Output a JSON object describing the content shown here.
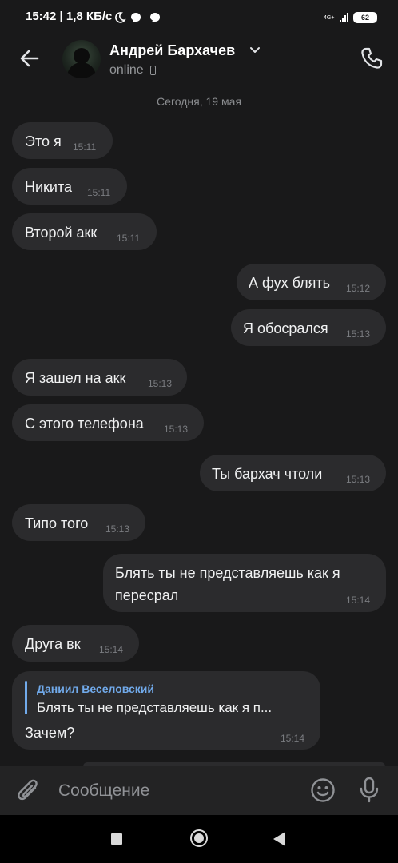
{
  "status_bar": {
    "time_and_speed": "15:42 | 1,8 КБ/с",
    "network": "4G+",
    "battery": "62"
  },
  "header": {
    "contact_name": "Андрей Бархачев",
    "status": "online"
  },
  "date_separator": "Сегодня, 19 мая",
  "messages": [
    {
      "text": "Это я",
      "time": "15:11",
      "side": "in"
    },
    {
      "text": "Никита",
      "time": "15:11",
      "side": "in"
    },
    {
      "text": "Второй акк",
      "time": "15:11",
      "side": "in"
    },
    {
      "text": "А фух блять",
      "time": "15:12",
      "side": "out"
    },
    {
      "text": "Я обосрался",
      "time": "15:13",
      "side": "out"
    },
    {
      "text": "Я зашел на акк",
      "time": "15:13",
      "side": "in"
    },
    {
      "text": "С этого телефона",
      "time": "15:13",
      "side": "in"
    },
    {
      "text": "Ты бархач чтоли",
      "time": "15:13",
      "side": "out"
    },
    {
      "text": "Типо того",
      "time": "15:13",
      "side": "in"
    },
    {
      "text_line1": "Блять ты не представляешь как я",
      "text_line2": "пересрал",
      "time": "15:14",
      "side": "out"
    },
    {
      "text": "Друга вк",
      "time": "15:14",
      "side": "in"
    },
    {
      "reply_author": "Даниил Веселовский",
      "reply_text": "Блять ты не представляешь как я п...",
      "text": "Зачем?",
      "time": "15:14",
      "side": "in"
    }
  ],
  "composer": {
    "placeholder": "Сообщение"
  },
  "icons": [
    "back-arrow-icon",
    "chevron-down-icon",
    "phone-icon",
    "call-icon",
    "attach-icon",
    "smile-icon",
    "mic-icon"
  ]
}
